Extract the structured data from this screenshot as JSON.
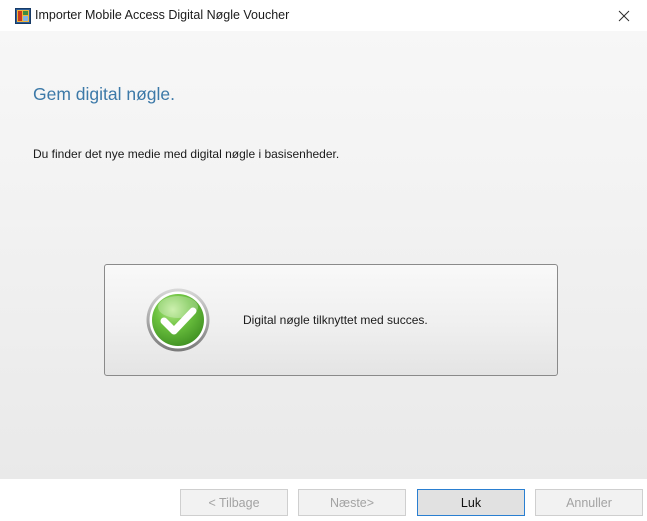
{
  "window": {
    "title": "Importer Mobile Access Digital Nøgle Voucher",
    "app_icon": "app-icon",
    "close_icon": "close-icon"
  },
  "main": {
    "heading": "Gem digital nøgle.",
    "description": "Du finder det nye medie med digital nøgle i basisenheder."
  },
  "status": {
    "icon": "check-circle-icon",
    "message": "Digital nøgle tilknyttet med succes."
  },
  "buttons": {
    "back": "< Tilbage",
    "next": "Næste>",
    "close": "Luk",
    "cancel": "Annuller"
  },
  "colors": {
    "heading": "#3c79a8",
    "success_green": "#5cb53a",
    "primary_button_border": "#2a7fd1"
  }
}
